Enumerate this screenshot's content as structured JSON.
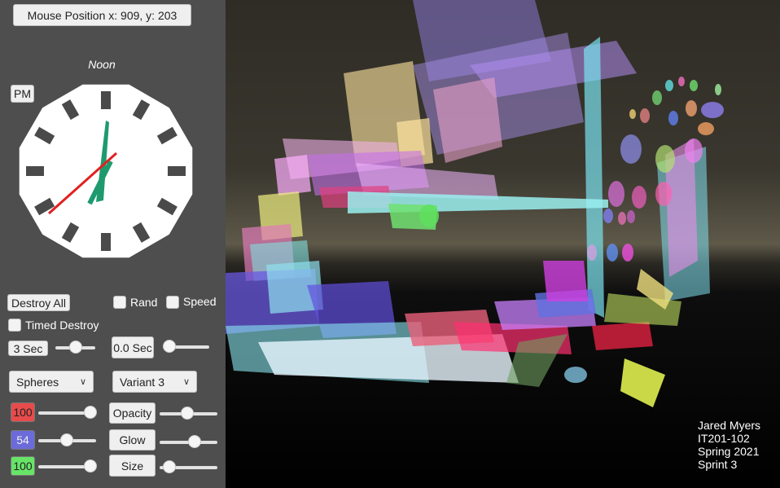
{
  "mouse_position": "Mouse Position x: 909, y: 203",
  "clock": {
    "period_label": "Noon",
    "ampm_button": "PM",
    "hour_hand_color": "#1e9a6e",
    "second_hand_color": "#e02020"
  },
  "controls": {
    "destroy_all": "Destroy All",
    "rand_label": "Rand",
    "speed_label": "Speed",
    "timed_destroy_label": "Timed Destroy",
    "destroy_time_value": "3 Sec",
    "speed_time_value": "0.0 Sec",
    "shape_select": "Spheres",
    "variant_select": "Variant 3"
  },
  "color": {
    "red": "100",
    "blue": "54",
    "green": "100",
    "red_level": 1.0,
    "blue_level": 0.54,
    "green_level": 1.0
  },
  "effects": {
    "opacity_label": "Opacity",
    "glow_label": "Glow",
    "size_label": "Size"
  },
  "credits": [
    "Jared Myers",
    "IT201-102",
    "Spring 2021",
    "Sprint 3"
  ]
}
